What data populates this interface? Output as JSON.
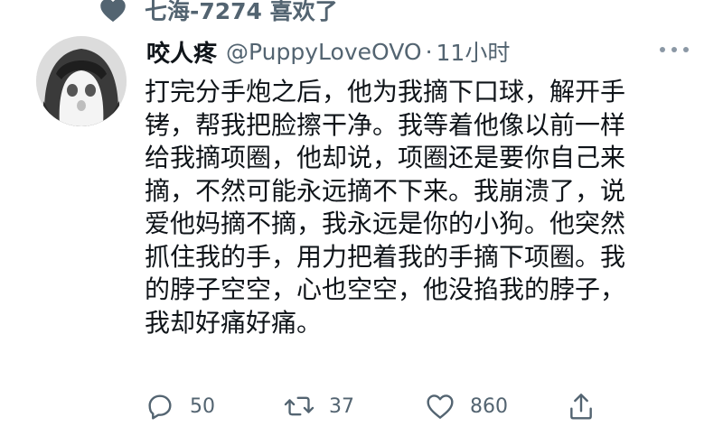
{
  "social_context": {
    "icon": "heart-icon",
    "text": "七海-7274 喜欢了"
  },
  "tweet": {
    "display_name": "咬人疼",
    "handle": "@PuppyLoveOVO",
    "separator": "·",
    "time": "11小时",
    "text_lines": [
      "打完分手炮之后，他为我摘下口球，解开手",
      "铐，帮我把脸擦干净。我等着他像以前一样",
      "给我摘项圈，他却说，项圈还是要你自己来",
      "摘，不然可能永远摘不下来。我崩溃了，说",
      "爱他妈摘不摘，我永远是你的小狗。他突然",
      "抓住我的手，用力把着我的手摘下项圈。我",
      "的脖子空空，心也空空，他没掐我的脖子，",
      "我却好痛好痛。"
    ]
  },
  "actions": {
    "reply_count": "50",
    "retweet_count": "37",
    "like_count": "860"
  },
  "colors": {
    "text_primary": "#0f1419",
    "text_secondary": "#536471",
    "icon": "#536471"
  }
}
